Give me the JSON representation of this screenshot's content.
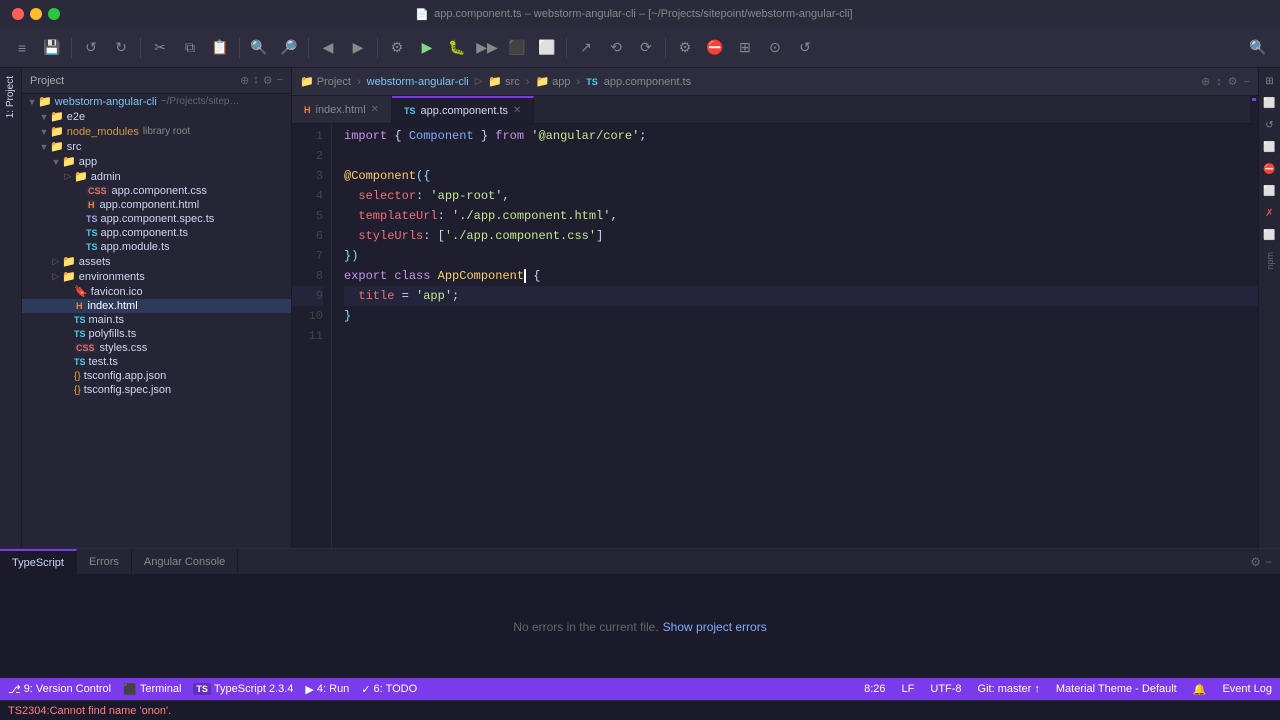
{
  "titlebar": {
    "title": "app.component.ts – webstorm-angular-cli – [~/Projects/sitepoint/webstorm-angular-cli]",
    "file_icon": "📄"
  },
  "toolbar": {
    "buttons": [
      "≡",
      "💾",
      "↺",
      "←",
      "→",
      "✂",
      "⧉",
      "⬛",
      "🔍",
      "🔎",
      "◀",
      "▶",
      "⊕",
      "▶",
      "⏸",
      "⏹",
      "▶▶",
      "⬛",
      "⬜",
      "▶|",
      "↗",
      "⟲",
      "⟳",
      "⚙",
      "⛔",
      "⊞",
      "⊙",
      "↺",
      "🔍"
    ]
  },
  "project_bar": {
    "items": [
      "webstorm-angular-cli",
      "src",
      "app",
      "app.component.ts"
    ],
    "actions": [
      "📁",
      "↕",
      "⚙",
      "−"
    ]
  },
  "tabs": {
    "editor_tabs": [
      {
        "label": "index.html",
        "icon": "🌐",
        "active": false
      },
      {
        "label": "app.component.ts",
        "icon": "TS",
        "active": true
      }
    ]
  },
  "file_tree": {
    "header": "Project",
    "items": [
      {
        "indent": 0,
        "arrow": "▼",
        "icon": "📁",
        "name": "webstorm-angular-cli",
        "detail": "~/Projects/sitep…",
        "type": "folder"
      },
      {
        "indent": 1,
        "arrow": "▼",
        "icon": "📁",
        "name": "e2e",
        "detail": "",
        "type": "folder"
      },
      {
        "indent": 1,
        "arrow": "▼",
        "icon": "📁",
        "name": "node_modules",
        "detail": "library root",
        "type": "folder-lib"
      },
      {
        "indent": 1,
        "arrow": "▼",
        "icon": "📁",
        "name": "src",
        "detail": "",
        "type": "folder"
      },
      {
        "indent": 2,
        "arrow": "▼",
        "icon": "📁",
        "name": "app",
        "detail": "",
        "type": "folder"
      },
      {
        "indent": 3,
        "arrow": "▷",
        "icon": "📁",
        "name": "admin",
        "detail": "",
        "type": "folder"
      },
      {
        "indent": 3,
        "arrow": "",
        "icon": "CSS",
        "name": "app.component.css",
        "detail": "",
        "type": "css"
      },
      {
        "indent": 3,
        "arrow": "",
        "icon": "HTML",
        "name": "app.component.html",
        "detail": "",
        "type": "html"
      },
      {
        "indent": 3,
        "arrow": "",
        "icon": "SPEC",
        "name": "app.component.spec.ts",
        "detail": "",
        "type": "spec"
      },
      {
        "indent": 3,
        "arrow": "",
        "icon": "TS",
        "name": "app.component.ts",
        "detail": "",
        "type": "ts"
      },
      {
        "indent": 3,
        "arrow": "",
        "icon": "TS",
        "name": "app.module.ts",
        "detail": "",
        "type": "ts"
      },
      {
        "indent": 2,
        "arrow": "▷",
        "icon": "📁",
        "name": "assets",
        "detail": "",
        "type": "folder"
      },
      {
        "indent": 2,
        "arrow": "▷",
        "icon": "📁",
        "name": "environments",
        "detail": "",
        "type": "folder"
      },
      {
        "indent": 2,
        "arrow": "",
        "icon": "🔖",
        "name": "favicon.ico",
        "detail": "",
        "type": "ico"
      },
      {
        "indent": 2,
        "arrow": "",
        "icon": "HTML",
        "name": "index.html",
        "detail": "",
        "type": "html"
      },
      {
        "indent": 2,
        "arrow": "",
        "icon": "TS",
        "name": "main.ts",
        "detail": "",
        "type": "ts"
      },
      {
        "indent": 2,
        "arrow": "",
        "icon": "TS",
        "name": "polyfills.ts",
        "detail": "",
        "type": "ts"
      },
      {
        "indent": 2,
        "arrow": "",
        "icon": "CSS",
        "name": "styles.css",
        "detail": "",
        "type": "css"
      },
      {
        "indent": 2,
        "arrow": "",
        "icon": "TS",
        "name": "test.ts",
        "detail": "",
        "type": "ts"
      },
      {
        "indent": 2,
        "arrow": "",
        "icon": "{}",
        "name": "tsconfig.app.json",
        "detail": "",
        "type": "json"
      },
      {
        "indent": 2,
        "arrow": "",
        "icon": "{}",
        "name": "tsconfig.spec.json",
        "detail": "",
        "type": "json"
      }
    ]
  },
  "code": {
    "filename": "app.component.ts",
    "lines": [
      {
        "num": 1,
        "content": "import { Component } from '@angular/core';"
      },
      {
        "num": 2,
        "content": ""
      },
      {
        "num": 3,
        "content": "@Component({"
      },
      {
        "num": 4,
        "content": "  selector: 'app-root',"
      },
      {
        "num": 5,
        "content": "  templateUrl: './app.component.html',"
      },
      {
        "num": 6,
        "content": "  styleUrls: ['./app.component.css']"
      },
      {
        "num": 7,
        "content": "})"
      },
      {
        "num": 8,
        "content": "export class AppComponent {"
      },
      {
        "num": 9,
        "content": "  title = 'app';"
      },
      {
        "num": 10,
        "content": "}"
      },
      {
        "num": 11,
        "content": ""
      }
    ]
  },
  "bottom_panel": {
    "tabs": [
      "TypeScript",
      "Errors",
      "Angular Console"
    ],
    "content": "No errors in the current file.",
    "link": "Show project errors",
    "active_tab": "TypeScript"
  },
  "status_bar": {
    "items_left": [
      {
        "icon": "⎇",
        "label": "9: Version Control"
      },
      {
        "icon": "⬛",
        "label": "Terminal"
      },
      {
        "icon": "TS",
        "label": "TypeScript 2.3.4"
      },
      {
        "icon": "▶",
        "label": "4: Run"
      },
      {
        "icon": "✓",
        "label": "6: TODO"
      }
    ],
    "items_right": [
      {
        "label": "8:26"
      },
      {
        "label": "LF"
      },
      {
        "label": "UTF-8"
      },
      {
        "label": "Git: master"
      },
      {
        "icon": "🔔",
        "label": "Event Log"
      }
    ],
    "theme": "Material Theme - Default"
  },
  "error_bar": {
    "text": "TS2304:Cannot find name 'onon'."
  },
  "left_tools": {
    "items": [
      "⊞",
      "⬜",
      "↺",
      "⬜",
      "⛔",
      "⬜",
      "✗",
      "⬜",
      "npm"
    ]
  }
}
